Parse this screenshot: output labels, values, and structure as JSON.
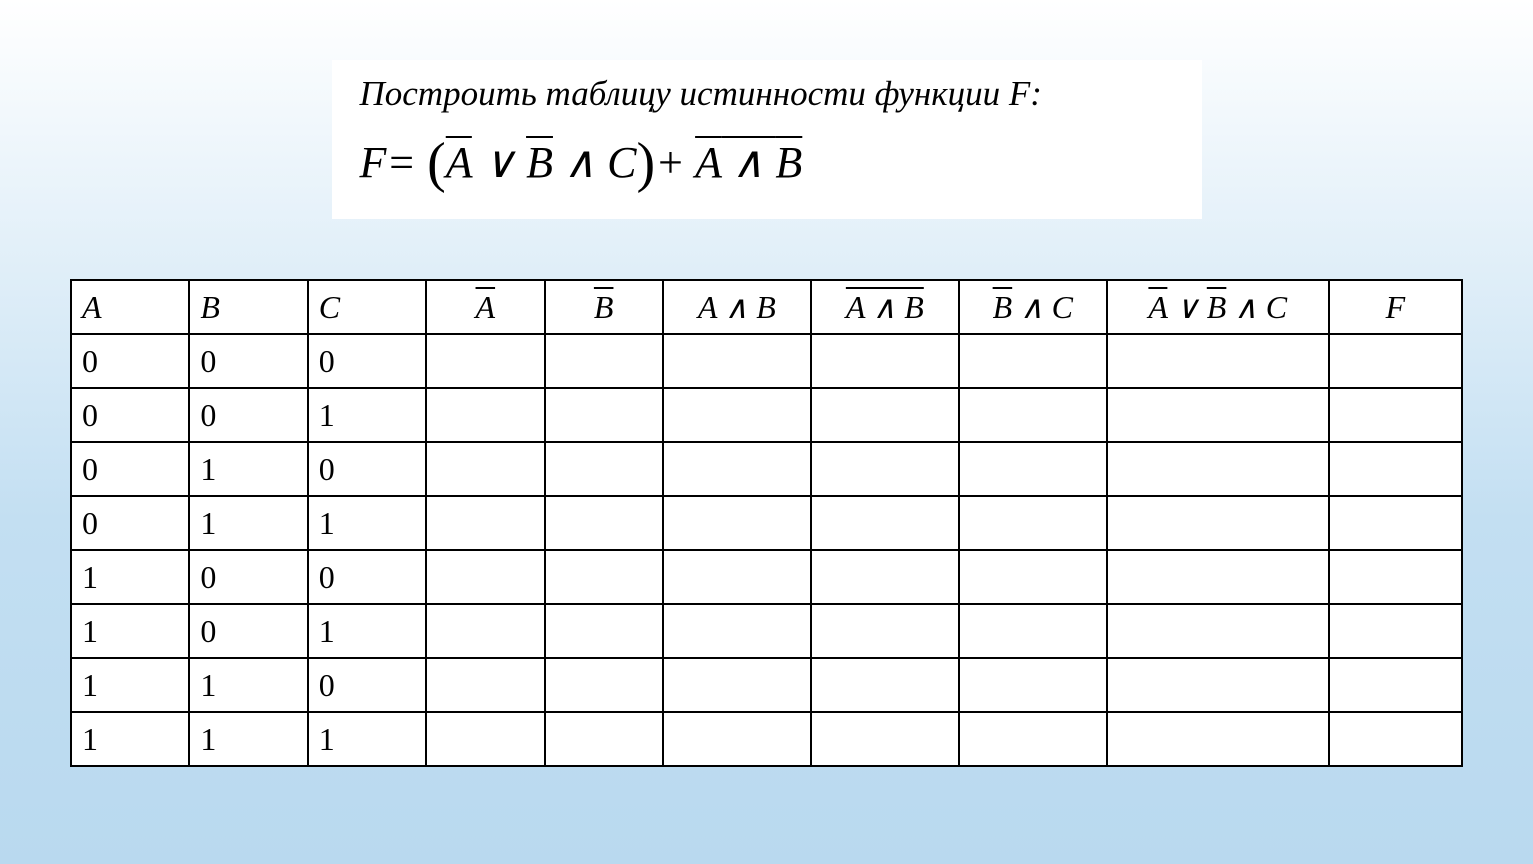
{
  "problem": {
    "prompt": "Построить таблицу истинности функции F:",
    "formula_plain": "F = (¬A ∨ ¬B ∧ C) + ¬(A ∧ B)"
  },
  "table": {
    "headers": {
      "A": "A",
      "B": "B",
      "C": "C",
      "notA": "A",
      "notB": "B",
      "AandB": "A ∧ B",
      "notAandB": "A ∧ B",
      "notBandC": "B ∧ C",
      "expr": "A ∨ B ∧ C",
      "F": "F"
    },
    "rows": [
      {
        "A": "0",
        "B": "0",
        "C": "0",
        "notA": "",
        "notB": "",
        "AandB": "",
        "notAandB": "",
        "notBandC": "",
        "expr": "",
        "F": ""
      },
      {
        "A": "0",
        "B": "0",
        "C": "1",
        "notA": "",
        "notB": "",
        "AandB": "",
        "notAandB": "",
        "notBandC": "",
        "expr": "",
        "F": ""
      },
      {
        "A": "0",
        "B": "1",
        "C": "0",
        "notA": "",
        "notB": "",
        "AandB": "",
        "notAandB": "",
        "notBandC": "",
        "expr": "",
        "F": ""
      },
      {
        "A": "0",
        "B": "1",
        "C": "1",
        "notA": "",
        "notB": "",
        "AandB": "",
        "notAandB": "",
        "notBandC": "",
        "expr": "",
        "F": ""
      },
      {
        "A": "1",
        "B": "0",
        "C": "0",
        "notA": "",
        "notB": "",
        "AandB": "",
        "notAandB": "",
        "notBandC": "",
        "expr": "",
        "F": ""
      },
      {
        "A": "1",
        "B": "0",
        "C": "1",
        "notA": "",
        "notB": "",
        "AandB": "",
        "notAandB": "",
        "notBandC": "",
        "expr": "",
        "F": ""
      },
      {
        "A": "1",
        "B": "1",
        "C": "0",
        "notA": "",
        "notB": "",
        "AandB": "",
        "notAandB": "",
        "notBandC": "",
        "expr": "",
        "F": ""
      },
      {
        "A": "1",
        "B": "1",
        "C": "1",
        "notA": "",
        "notB": "",
        "AandB": "",
        "notAandB": "",
        "notBandC": "",
        "expr": "",
        "F": ""
      }
    ]
  }
}
